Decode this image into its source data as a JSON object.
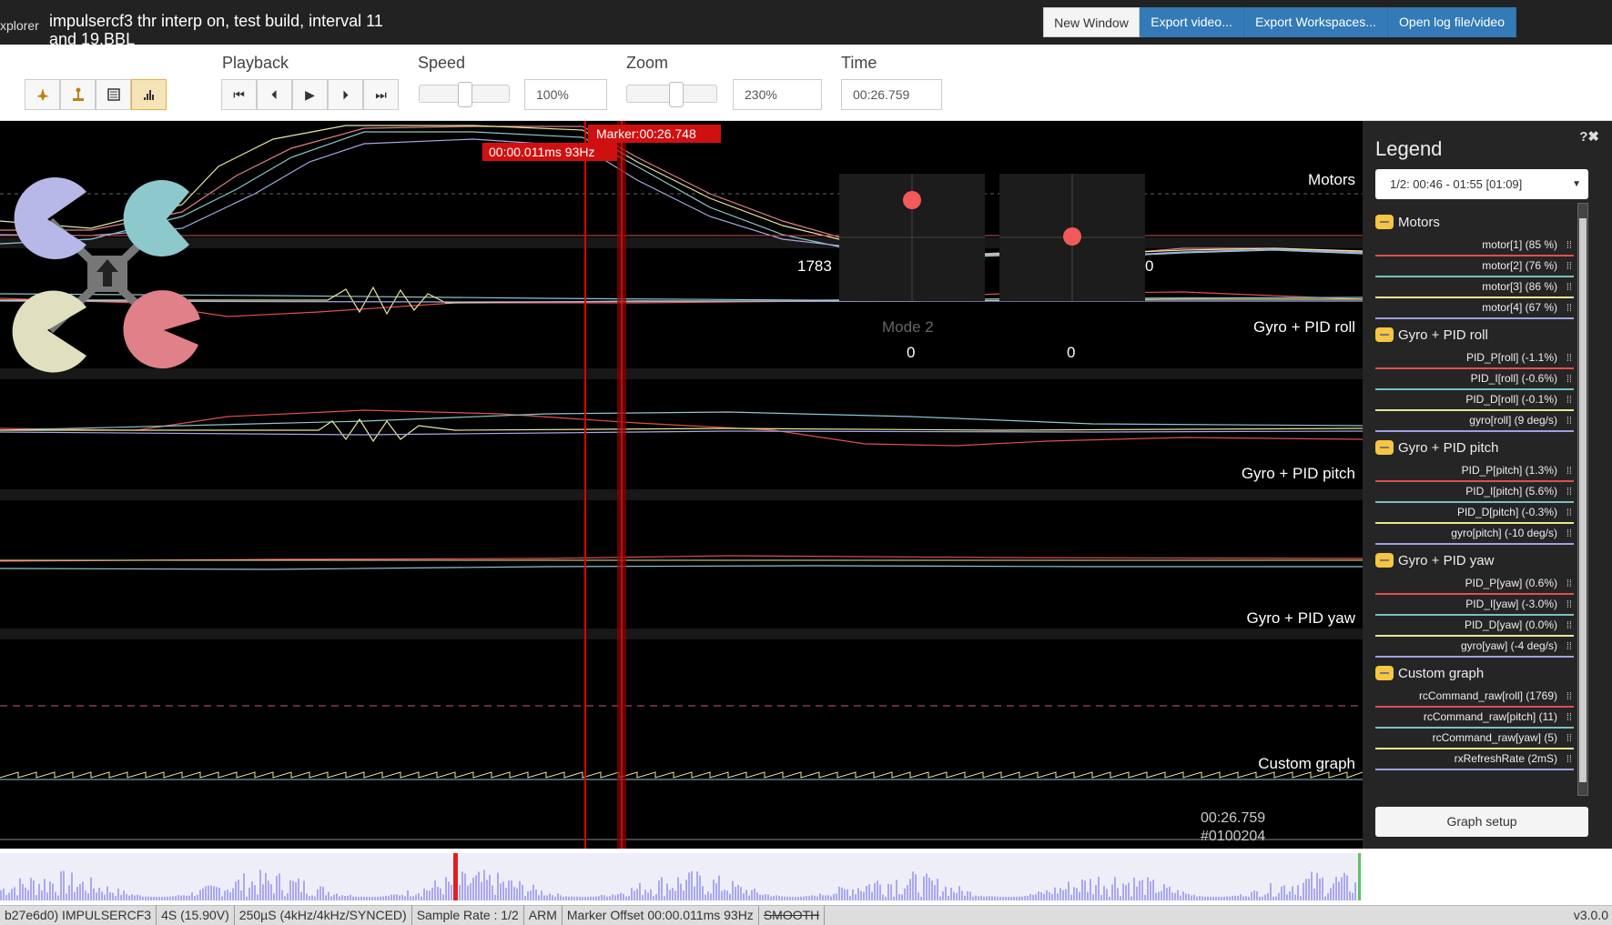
{
  "app": {
    "name_fragment": "xplorer",
    "title": "impulsercf3 thr interp on, test build, interval 11 and 19.BBL"
  },
  "top_buttons": {
    "new_window": "New Window",
    "export_video": "Export video...",
    "export_workspaces": "Export Workspaces...",
    "open_log": "Open log file/video"
  },
  "toolbar": {
    "view_icons": [
      "craft-icon",
      "sticks-icon",
      "table-icon",
      "analyser-icon"
    ],
    "playback_label": "Playback",
    "speed_label": "Speed",
    "speed_value": "100%",
    "speed_level": 0.5,
    "zoom_label": "Zoom",
    "zoom_value": "230%",
    "zoom_level": 0.55,
    "time_label": "Time",
    "time_value": "00:26.759"
  },
  "graph": {
    "marker_label": "Marker:00:26.748",
    "marker_offset_label": "00:00.011ms 93Hz",
    "group_labels": {
      "motors": "Motors",
      "roll": "Gyro + PID roll",
      "pitch": "Gyro + PID pitch",
      "yaw": "Gyro + PID yaw",
      "custom": "Custom graph"
    },
    "stick_values": {
      "left_throttle": "1783",
      "left_yaw": "0",
      "right_roll": "0",
      "right_pitch": "0",
      "mode": "Mode 2"
    },
    "current_time": "00:26.759",
    "current_frame": "#0100204",
    "motor_colors": [
      "#b8b8e8",
      "#8cc8cc",
      "#e8e8c0",
      "#e08088"
    ]
  },
  "legend": {
    "title": "Legend",
    "help": "?✖",
    "selected_range": "1/2: 00:46 - 01:55 [01:09]",
    "groups": [
      {
        "name": "Motors",
        "items": [
          {
            "label": "motor[1] (85 %)",
            "color": "#e05050"
          },
          {
            "label": "motor[2] (76 %)",
            "color": "#7ac0c0"
          },
          {
            "label": "motor[3] (86 %)",
            "color": "#e8e890"
          },
          {
            "label": "motor[4] (67 %)",
            "color": "#a0a0e0"
          }
        ]
      },
      {
        "name": "Gyro + PID roll",
        "items": [
          {
            "label": "PID_P[roll] (-1.1%)",
            "color": "#e05050"
          },
          {
            "label": "PID_I[roll] (-0.6%)",
            "color": "#7ac0c0"
          },
          {
            "label": "PID_D[roll] (-0.1%)",
            "color": "#e8e890"
          },
          {
            "label": "gyro[roll] (9 deg/s)",
            "color": "#a0a0e0"
          }
        ]
      },
      {
        "name": "Gyro + PID pitch",
        "items": [
          {
            "label": "PID_P[pitch] (1.3%)",
            "color": "#e05050"
          },
          {
            "label": "PID_I[pitch] (5.6%)",
            "color": "#7ac0c0"
          },
          {
            "label": "PID_D[pitch] (-0.3%)",
            "color": "#e8e890"
          },
          {
            "label": "gyro[pitch] (-10 deg/s)",
            "color": "#a0a0e0"
          }
        ]
      },
      {
        "name": "Gyro + PID yaw",
        "items": [
          {
            "label": "PID_P[yaw] (0.6%)",
            "color": "#e05050"
          },
          {
            "label": "PID_I[yaw] (-3.0%)",
            "color": "#7ac0c0"
          },
          {
            "label": "PID_D[yaw] (0.0%)",
            "color": "#e8e890"
          },
          {
            "label": "gyro[yaw] (-4 deg/s)",
            "color": "#a0a0e0"
          }
        ]
      },
      {
        "name": "Custom graph",
        "items": [
          {
            "label": "rcCommand_raw[roll] (1769)",
            "color": "#e05050"
          },
          {
            "label": "rcCommand_raw[pitch] (11)",
            "color": "#7ac0c0"
          },
          {
            "label": "rcCommand_raw[yaw] (5)",
            "color": "#e8e890"
          },
          {
            "label": "rxRefreshRate (2mS)",
            "color": "#a0a0e0"
          }
        ]
      }
    ],
    "graph_setup": "Graph setup"
  },
  "status": {
    "items": [
      "b27e6d0) IMPULSERCF3",
      "4S (15.90V)",
      "250µS (4kHz/4kHz/SYNCED)",
      "Sample Rate : 1/2",
      "ARM",
      "Marker Offset 00:00.011ms 93Hz"
    ],
    "smooth": "SMOOTH",
    "version": "v3.0.0"
  },
  "colors": {
    "accent": "#337ab7",
    "marker": "#e00000",
    "active_toggle": "#f6c542"
  }
}
